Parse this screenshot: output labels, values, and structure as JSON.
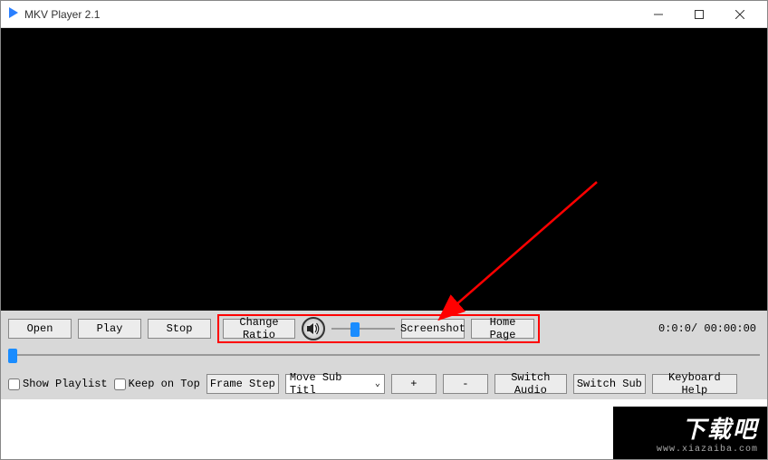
{
  "titlebar": {
    "title": "MKV Player 2.1"
  },
  "row1": {
    "open": "Open",
    "play": "Play",
    "stop": "Stop",
    "change_ratio": "Change Ratio",
    "screenshot": "Screenshot",
    "home_page": "Home Page",
    "time": "0:0:0/ 00:00:00"
  },
  "volume": {
    "percent": 30
  },
  "seek": {
    "percent": 0
  },
  "row2": {
    "show_playlist": "Show Playlist",
    "keep_on_top": "Keep on Top",
    "frame_step": "Frame Step",
    "move_sub": "Move Sub Titl",
    "plus": "+",
    "minus": "-",
    "switch_audio": "Switch Audio",
    "switch_sub": "Switch Sub",
    "keyboard_help": "Keyboard Help"
  },
  "watermark": {
    "text": "下载吧",
    "url": "www.xiazaiba.com"
  },
  "colors": {
    "highlight": "#ff0000",
    "slider_thumb": "#1a8cff"
  }
}
